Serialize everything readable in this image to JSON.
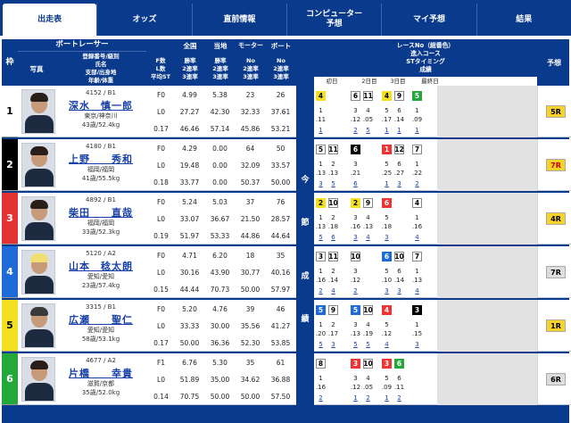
{
  "tabs": [
    {
      "label": "出走表",
      "active": true
    },
    {
      "label": "オッズ"
    },
    {
      "label": "直前情報"
    },
    {
      "label": "コンピューター",
      "sub": "予想"
    },
    {
      "label": "マイ予想"
    },
    {
      "label": "結果"
    }
  ],
  "header": {
    "waku": "枠",
    "photo": "写真",
    "boatracer": "ボートレーサー",
    "info_lines": [
      "登録番号/級別",
      "氏名",
      "支部/出身地",
      "年齢/体重"
    ],
    "fl": [
      "F数",
      "L数",
      "平均ST"
    ],
    "zenkoku": "全国",
    "touchi": "当地",
    "motor": "モーター",
    "boat": "ボート",
    "rate3": [
      "勝率",
      "2連率",
      "3連率"
    ],
    "no3": [
      "No",
      "2連率",
      "3連率"
    ],
    "race_lines": [
      "レースNo（総番色）",
      "進入コース",
      "STタイミング",
      "成績"
    ],
    "days": [
      "初日",
      "2日目",
      "3日目",
      "最終日"
    ],
    "yoso": "予想",
    "mid_vertical": [
      "今",
      "節",
      "成",
      "績"
    ]
  },
  "colors": {
    "wk1": "#ffffff",
    "wk2": "#000000",
    "wk3": "#e33333",
    "wk4": "#1d6ad8",
    "wk5": "#f3e020",
    "wk6": "#25a83a",
    "navy": "#0a3a8c"
  },
  "racers": [
    {
      "reg": "4152 / B1",
      "name": "深水　慎一郎",
      "loc": "東京/神奈川",
      "ag": "43歳/52.4kg",
      "fl": [
        "F0",
        "L0",
        "0.17"
      ],
      "zen": [
        "4.99",
        "27.27",
        "46.46"
      ],
      "tou": [
        "5.38",
        "42.30",
        "57.14"
      ],
      "mot": [
        "23",
        "32.33",
        "45.86"
      ],
      "bot": [
        "26",
        "37.61",
        "53.21"
      ],
      "lanes": [
        "4",
        "",
        "6",
        "11",
        "4",
        "9",
        "5",
        ""
      ],
      "sts": [
        ".11",
        "",
        ".12",
        ".05",
        ".17",
        ".14",
        ".09",
        ""
      ],
      "rks": [
        "1",
        "",
        "2",
        "5",
        "1",
        "1",
        "1",
        ""
      ],
      "pred": "5R"
    },
    {
      "reg": "4180 / B1",
      "name": "上野　　秀和",
      "loc": "福岡/福岡",
      "ag": "41歳/55.5kg",
      "fl": [
        "F0",
        "L0",
        "0.18"
      ],
      "zen": [
        "4.29",
        "19.48",
        "33.77"
      ],
      "tou": [
        "0.00",
        "0.00",
        "0.00"
      ],
      "mot": [
        "64",
        "32.09",
        "50.37"
      ],
      "bot": [
        "50",
        "33.57",
        "50.00"
      ],
      "lanes": [
        "5",
        "11",
        "6",
        "",
        "1",
        "12",
        "7",
        ""
      ],
      "sts": [
        ".13",
        ".13",
        ".21",
        "",
        ".25",
        ".27",
        ".22",
        ""
      ],
      "rks": [
        "3",
        "5",
        "6",
        "",
        "1",
        "3",
        "2",
        ""
      ],
      "pred": "7R"
    },
    {
      "reg": "4892 / B1",
      "name": "柴田　　直哉",
      "loc": "福岡/福岡",
      "ag": "33歳/52.3kg",
      "fl": [
        "F0",
        "L0",
        "0.19"
      ],
      "zen": [
        "5.24",
        "33.07",
        "51.97"
      ],
      "tou": [
        "5.03",
        "36.67",
        "53.33"
      ],
      "mot": [
        "37",
        "21.50",
        "44.86"
      ],
      "bot": [
        "76",
        "28.57",
        "44.64"
      ],
      "lanes": [
        "2",
        "10",
        "2",
        "9",
        "6",
        "",
        "4",
        ""
      ],
      "sts": [
        ".13",
        ".18",
        ".16",
        ".13",
        ".18",
        "",
        ".16",
        ""
      ],
      "rks": [
        "5",
        "6",
        "3",
        "4",
        "3",
        "",
        "4",
        ""
      ],
      "pred": "4R"
    },
    {
      "reg": "5120 / A2",
      "name": "山本　稔太朗",
      "loc": "愛知/愛知",
      "ag": "23歳/57.4kg",
      "fl": [
        "F0",
        "L0",
        "0.15"
      ],
      "zen": [
        "4.71",
        "30.16",
        "44.44"
      ],
      "tou": [
        "6.20",
        "43.90",
        "70.73"
      ],
      "mot": [
        "18",
        "30.77",
        "50.00"
      ],
      "bot": [
        "35",
        "40.16",
        "57.97"
      ],
      "lanes": [
        "3",
        "11",
        "10",
        "",
        "6",
        "10",
        "7",
        ""
      ],
      "sts": [
        ".16",
        ".14",
        ".12",
        "",
        ".10",
        ".14",
        ".13",
        ""
      ],
      "rks": [
        "2",
        "4",
        "2",
        "",
        "3",
        "3",
        "4",
        ""
      ],
      "pred": "7R"
    },
    {
      "reg": "3315 / B1",
      "name": "広瀬　　聖仁",
      "loc": "愛知/愛知",
      "ag": "58歳/53.1kg",
      "fl": [
        "F0",
        "L0",
        "0.17"
      ],
      "zen": [
        "5.20",
        "33.33",
        "50.00"
      ],
      "tou": [
        "4.76",
        "30.00",
        "36.36"
      ],
      "mot": [
        "39",
        "35.56",
        "52.30"
      ],
      "bot": [
        "46",
        "41.27",
        "53.85"
      ],
      "lanes": [
        "5",
        "9",
        "5",
        "10",
        "4",
        "",
        "3",
        ""
      ],
      "sts": [
        ".20",
        ".17",
        ".13",
        ".19",
        ".12",
        "",
        ".15",
        ""
      ],
      "rks": [
        "5",
        "3",
        "5",
        "5",
        "4",
        "",
        "3",
        ""
      ],
      "pred": "1R"
    },
    {
      "reg": "4677 / A2",
      "name": "片橋　　幸貴",
      "loc": "滋賀/京都",
      "ag": "35歳/52.0kg",
      "fl": [
        "F1",
        "L0",
        "0.14"
      ],
      "zen": [
        "6.76",
        "51.89",
        "70.75"
      ],
      "tou": [
        "5.30",
        "35.00",
        "50.00"
      ],
      "mot": [
        "35",
        "34.62",
        "50.00"
      ],
      "bot": [
        "61",
        "36.88",
        "57.50"
      ],
      "lanes": [
        "8",
        "",
        "3",
        "10",
        "3",
        "6",
        "",
        ""
      ],
      "sts": [
        ".16",
        "",
        ".12",
        ".05",
        ".09",
        ".11",
        "",
        ""
      ],
      "rks": [
        "2",
        "",
        "1",
        "2",
        "1",
        "2",
        "",
        ""
      ],
      "pred": "6R"
    }
  ]
}
